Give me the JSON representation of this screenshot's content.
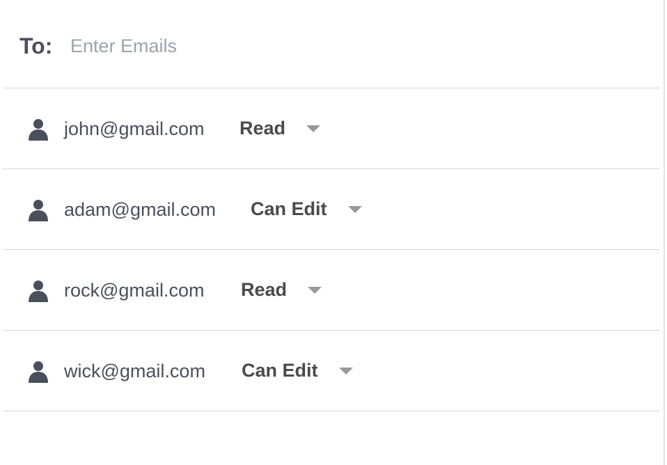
{
  "to_field": {
    "label": "To:",
    "placeholder": "Enter Emails",
    "value": ""
  },
  "shares": [
    {
      "email": "john@gmail.com",
      "permission": "Read"
    },
    {
      "email": "adam@gmail.com",
      "permission": "Can Edit"
    },
    {
      "email": "rock@gmail.com",
      "permission": "Read"
    },
    {
      "email": "wick@gmail.com",
      "permission": "Can Edit"
    }
  ],
  "icons": {
    "user": "person-icon",
    "dropdown": "caret-down-icon"
  },
  "colors": {
    "text": "#4a4f5c",
    "placeholder": "#9ea2ab",
    "permission": "#4a4a4a",
    "caret": "#999999",
    "divider": "#d6d6d6"
  }
}
